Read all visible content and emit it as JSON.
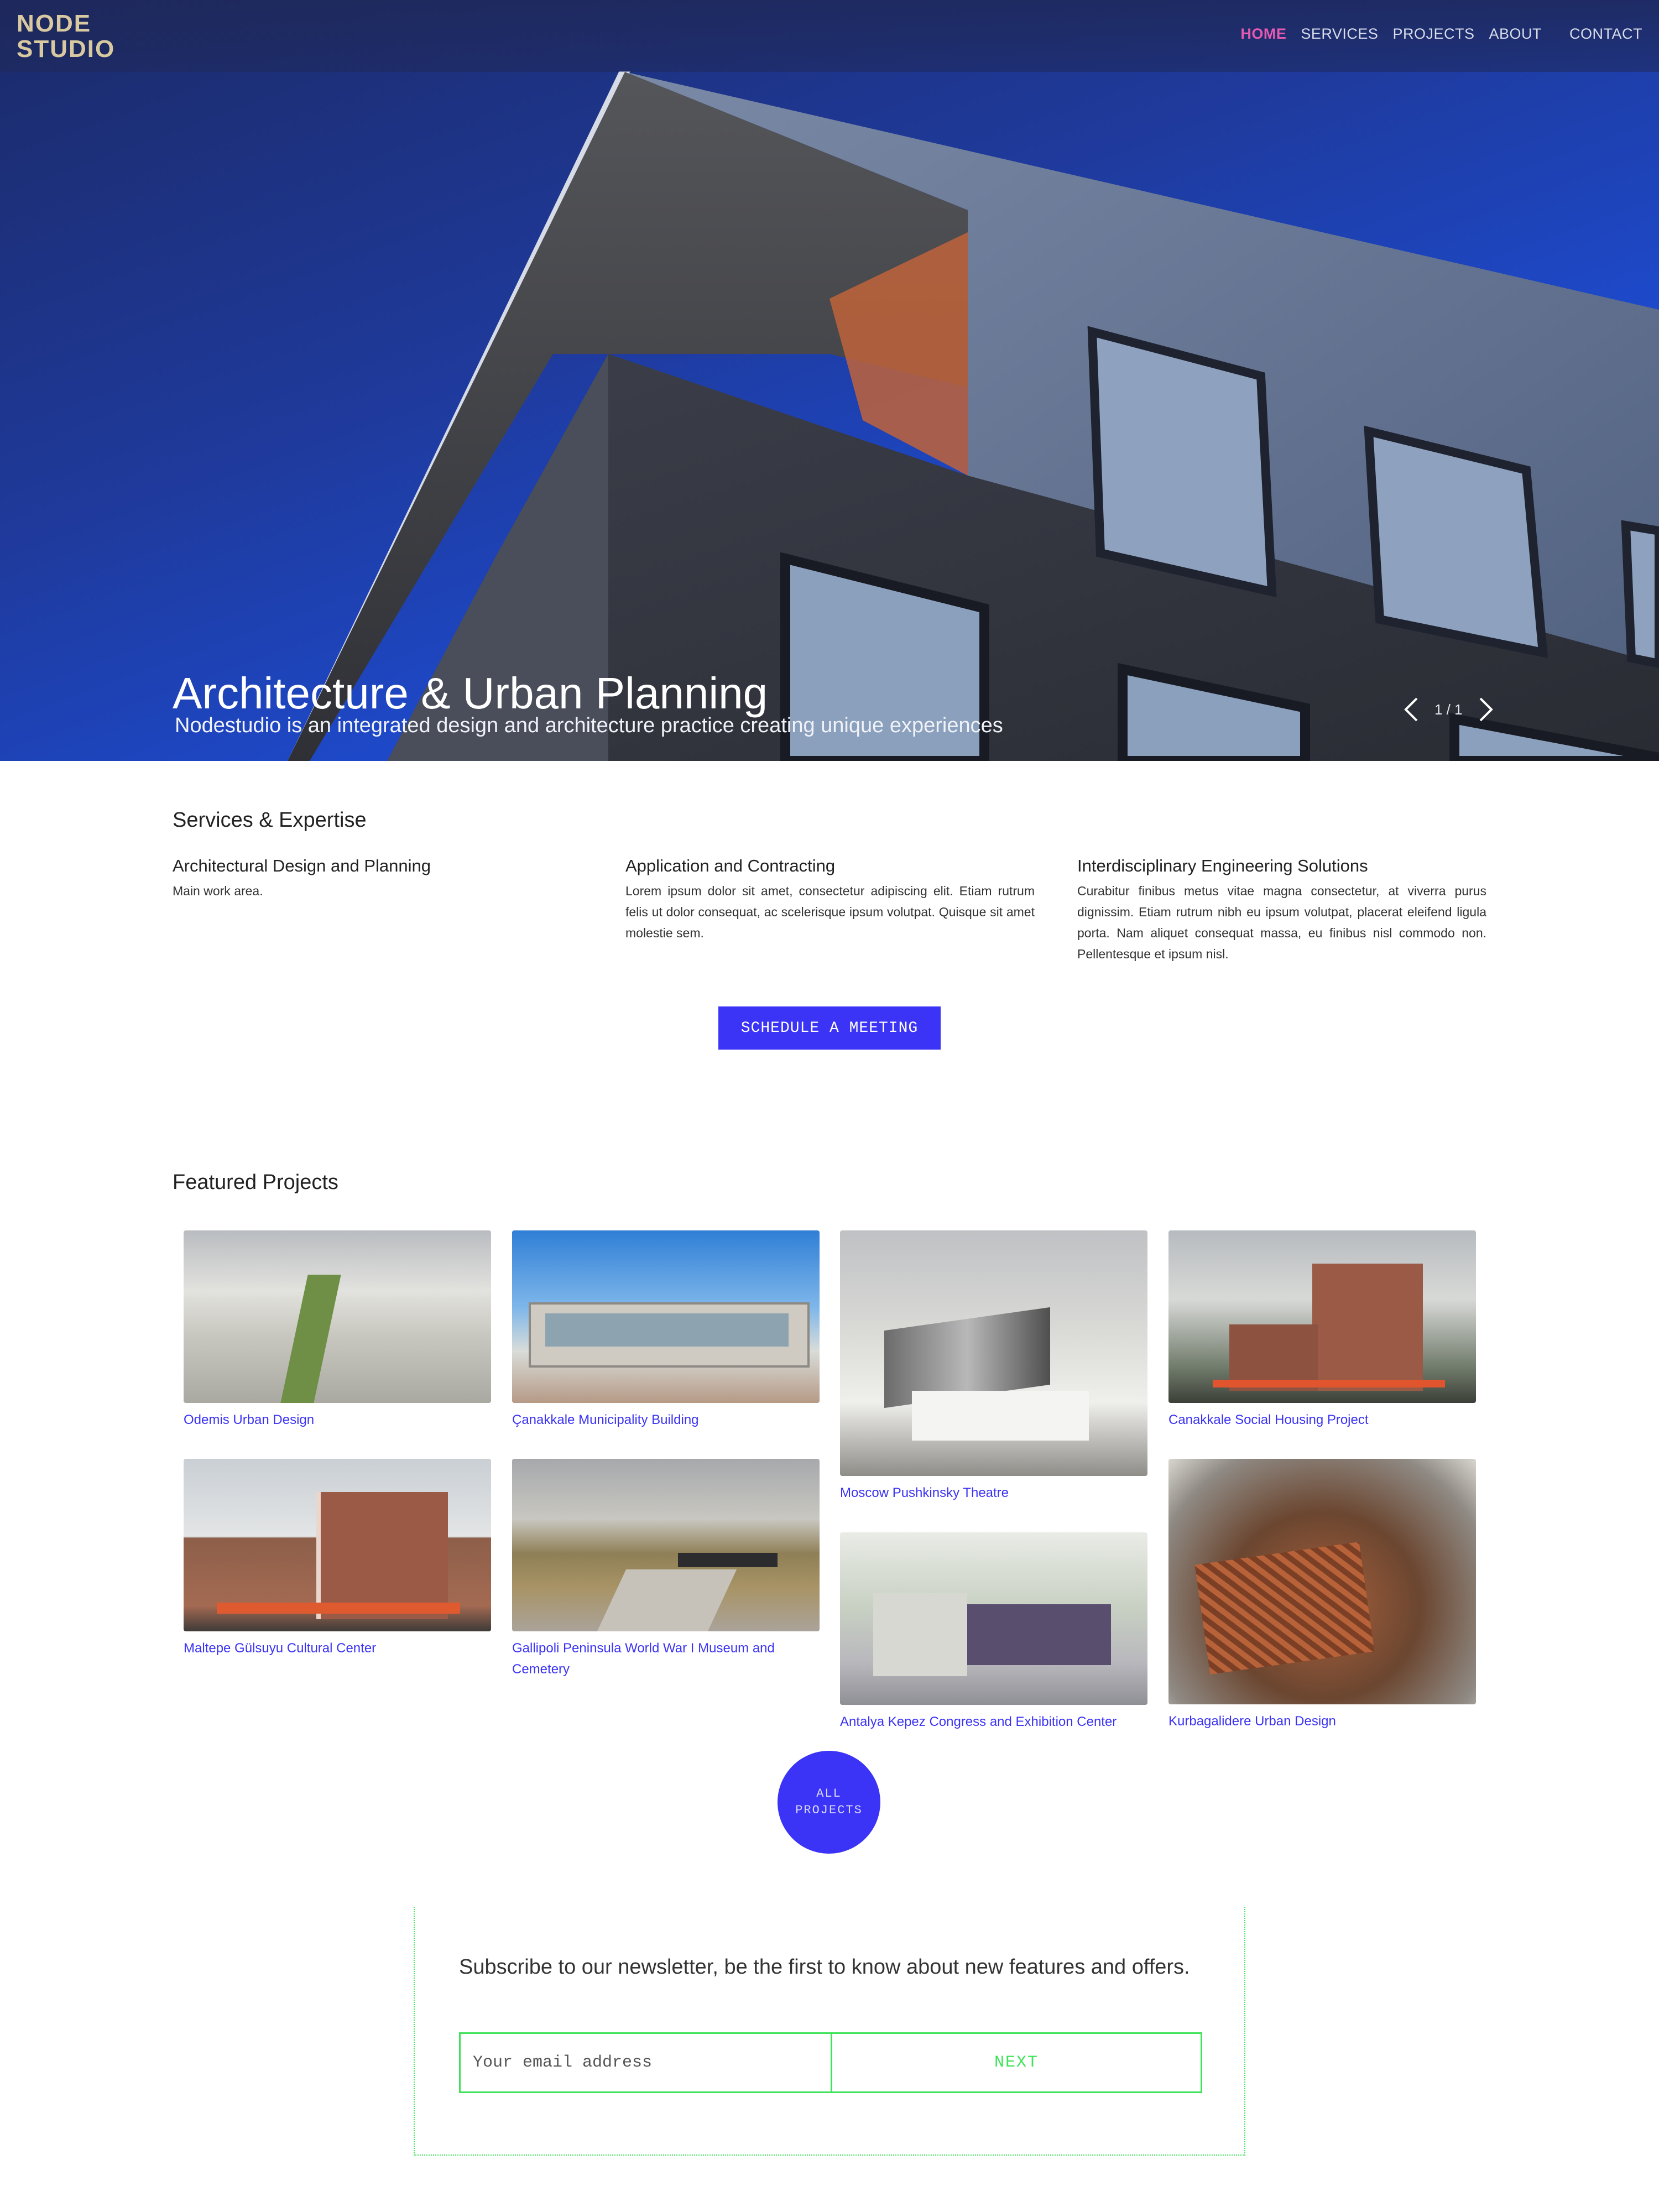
{
  "brand": {
    "logo_line1": "NODE",
    "logo_line2": "STUDIO",
    "logo_color": "#d9c9a0"
  },
  "nav": {
    "items": [
      {
        "label": "HOME",
        "active": true
      },
      {
        "label": "SERVICES"
      },
      {
        "label": "PROJECTS"
      },
      {
        "label": "ABOUT"
      },
      {
        "label": "CONTACT"
      }
    ],
    "active_color": "#e45ab1"
  },
  "hero": {
    "title": "Architecture & Urban Planning",
    "subtitle": "Nodestudio is an integrated design and architecture practice creating unique experiences",
    "slide_counter": "1 / 1",
    "prev_icon": "chevron-left-icon",
    "next_icon": "chevron-right-icon"
  },
  "services": {
    "title": "Services & Expertise",
    "items": [
      {
        "heading": "Architectural Design and Planning",
        "body": "Main work area."
      },
      {
        "heading": "Application and Contracting",
        "body": "Lorem ipsum dolor sit amet, consectetur adipiscing elit. Etiam rutrum felis ut dolor consequat, ac scelerisque ipsum volutpat. Quisque sit amet molestie sem."
      },
      {
        "heading": "Interdisciplinary Engineering Solutions",
        "body": "Curabitur finibus metus vitae magna consectetur, at viverra purus dignissim. Etiam rutrum nibh eu ipsum volutpat, placerat eleifend ligula porta. Nam aliquet consequat massa, eu finibus nisl commodo non. Pellentesque et ipsum nisl."
      }
    ],
    "cta_label": "SCHEDULE A MEETING"
  },
  "projects": {
    "title": "Featured Projects",
    "items": [
      {
        "name": "Odemis Urban Design"
      },
      {
        "name": "Çanakkale Municipality Building"
      },
      {
        "name": "Moscow Pushkinsky Theatre"
      },
      {
        "name": "Canakkale Social Housing Project"
      },
      {
        "name": "Maltepe Gülsuyu Cultural Center"
      },
      {
        "name": "Gallipoli Peninsula World War I Museum and Cemetery"
      },
      {
        "name": "Antalya Kepez Congress and Exhibition Center"
      },
      {
        "name": "Kurbagalidere Urban Design"
      }
    ],
    "all_label_line1": "ALL",
    "all_label_line2": "PROJECTS"
  },
  "newsletter": {
    "text": "Subscribe to our newsletter, be the first to know about new features and offers.",
    "email_placeholder": "Your email address",
    "submit_label": "NEXT",
    "accent_color": "#3fe35a"
  },
  "colors": {
    "primary": "#3b33f5",
    "link": "#3b33f5"
  }
}
